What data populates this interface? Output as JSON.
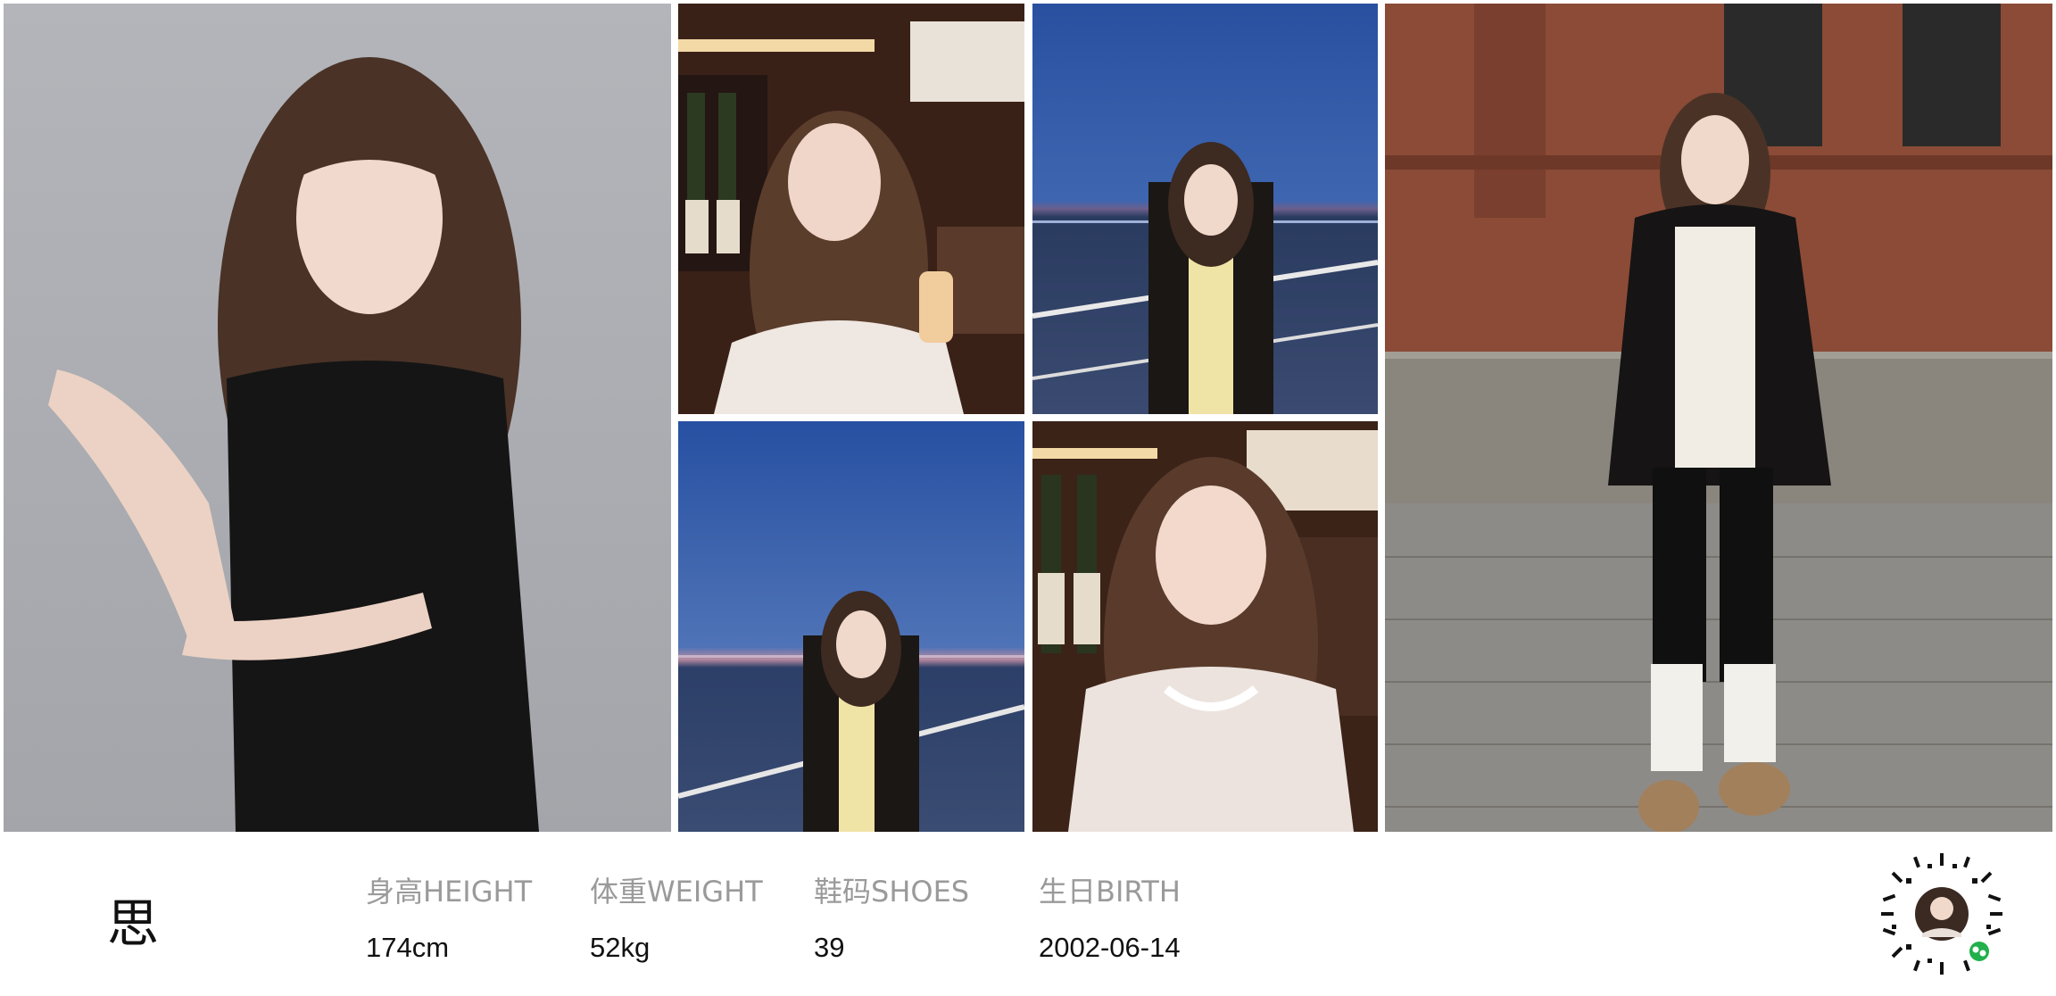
{
  "profile": {
    "name": "思",
    "stats": [
      {
        "label": "身高HEIGHT",
        "value": "174cm"
      },
      {
        "label": "体重WEIGHT",
        "value": "52kg"
      },
      {
        "label": "鞋码SHOES",
        "value": "39"
      },
      {
        "label": "生日BIRTH",
        "value": "2002-06-14"
      }
    ]
  },
  "colors": {
    "studio_bg": "#a9abb0",
    "bar_wood": "#3a2118",
    "night_sky": "#2b4f9c",
    "brick": "#8a4a36",
    "pavement": "#8b8a86"
  }
}
